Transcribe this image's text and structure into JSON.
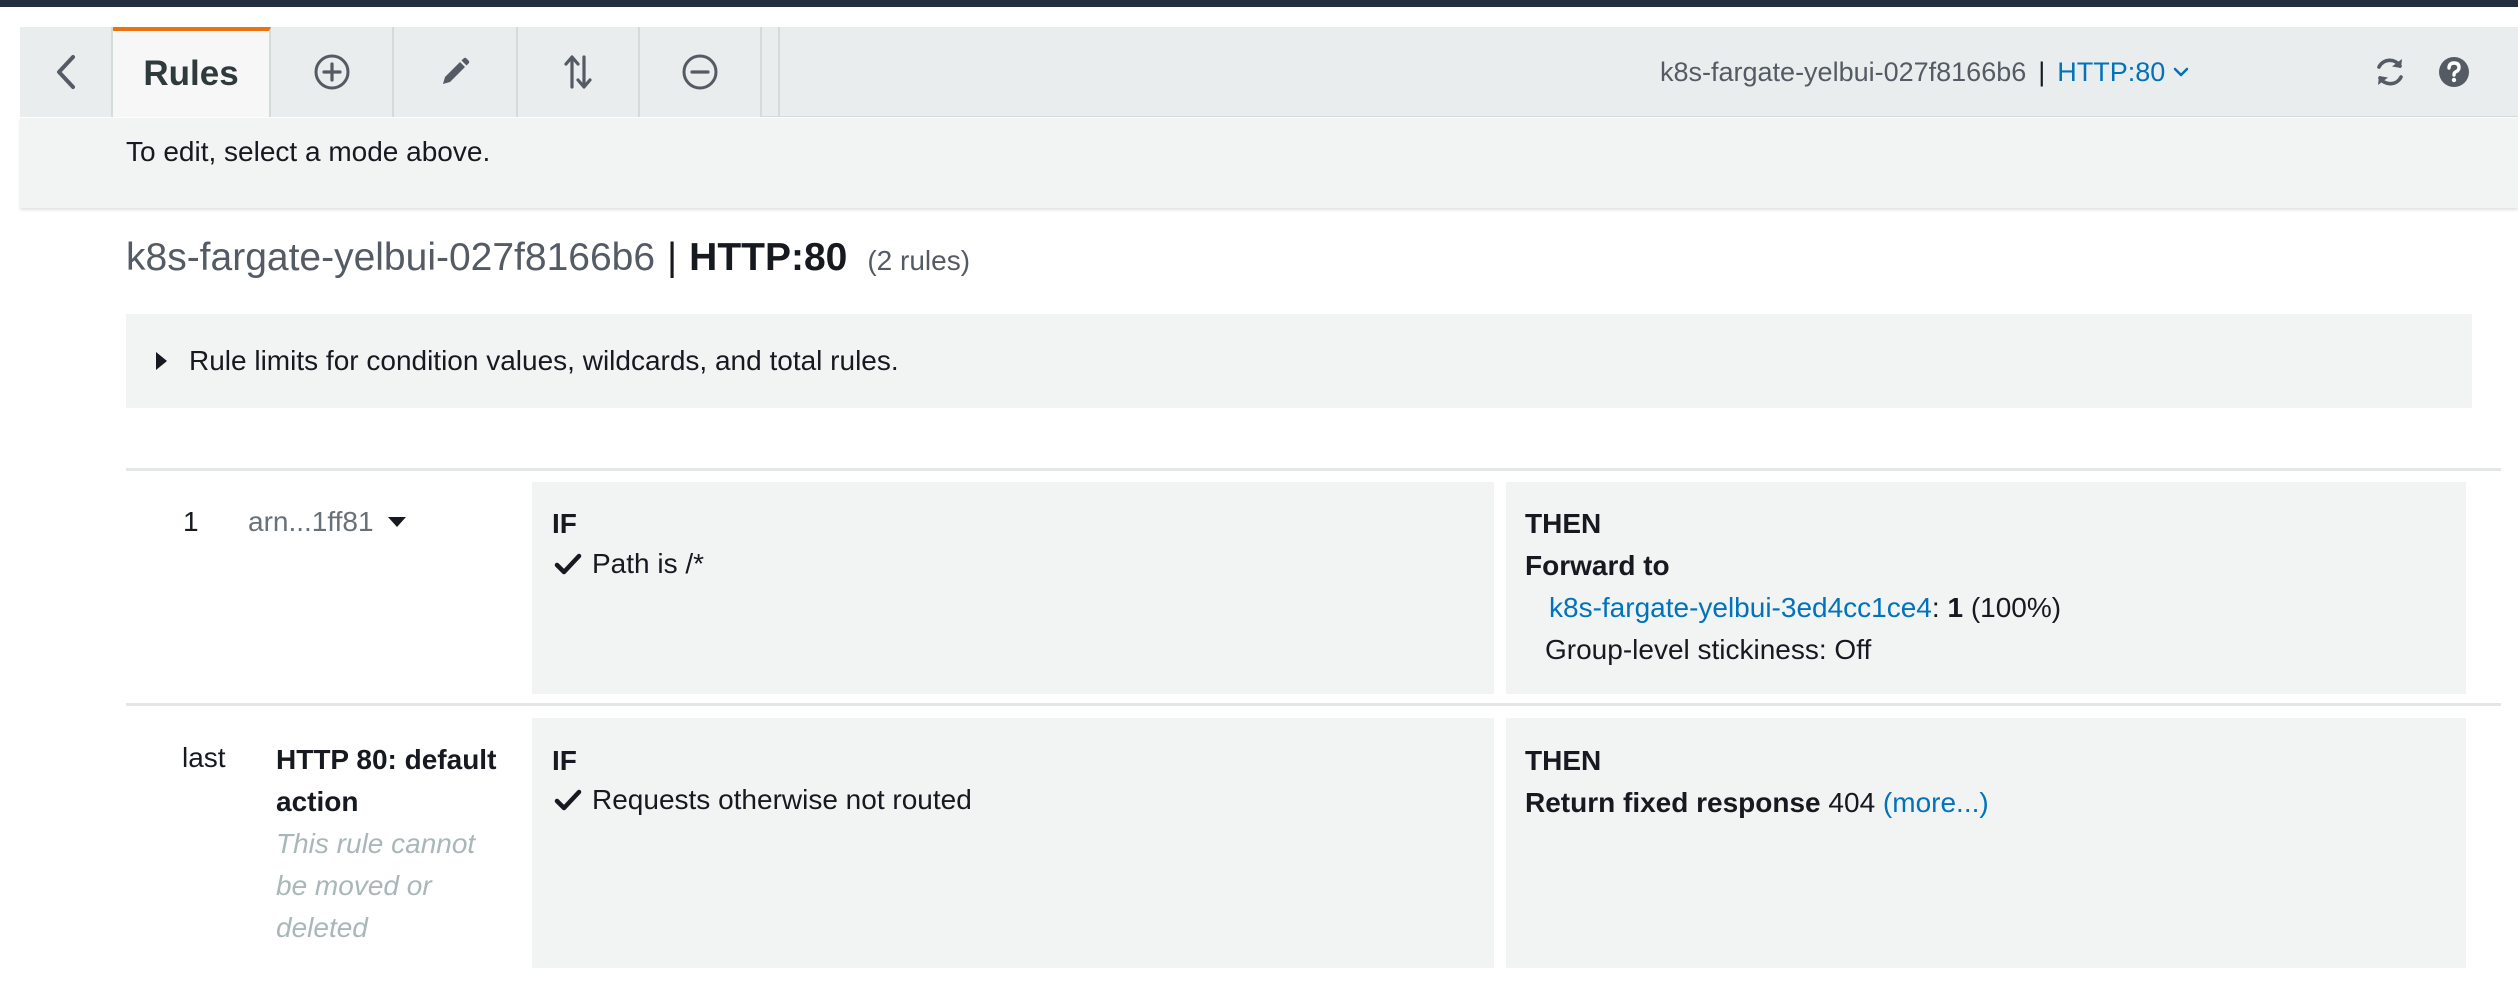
{
  "toolbar": {
    "tab_label": "Rules",
    "load_balancer": "k8s-fargate-yelbui-027f8166b6",
    "separator": "|",
    "listener": "HTTP:80"
  },
  "info": {
    "message": "To edit, select a mode above."
  },
  "heading": {
    "load_balancer": "k8s-fargate-yelbui-027f8166b6",
    "separator": "|",
    "listener": "HTTP:80",
    "rule_count": "(2 rules)"
  },
  "limits": {
    "label": "Rule limits for condition values, wildcards, and total rules."
  },
  "rules": [
    {
      "index": "1",
      "arn": "arn...1ff81",
      "if_label": "IF",
      "condition": "Path is /*",
      "then_label": "THEN",
      "action": "Forward to",
      "target_group": "k8s-fargate-yelbui-3ed4cc1ce4",
      "weight_sep": ":",
      "weight": "1",
      "weight_pct": "(100%)",
      "stickiness": "Group-level stickiness: Off"
    },
    {
      "index": "last",
      "name": "HTTP 80: default action",
      "note": "This rule cannot be moved or deleted",
      "if_label": "IF",
      "condition": "Requests otherwise not routed",
      "then_label": "THEN",
      "action": "Return fixed response",
      "status_code": "404",
      "more_link": "(more...)"
    }
  ],
  "icons": {
    "back": "chevron-left-icon",
    "add": "plus-circle-icon",
    "edit": "pencil-icon",
    "reorder": "reorder-arrows-icon",
    "delete": "minus-circle-icon",
    "refresh": "refresh-icon",
    "help": "help-icon",
    "check": "checkmark-icon"
  },
  "colors": {
    "accent_tab": "#ec7211",
    "link": "#0073bb",
    "header_bar": "#232f3e",
    "panel_bg": "#f2f3f3"
  }
}
